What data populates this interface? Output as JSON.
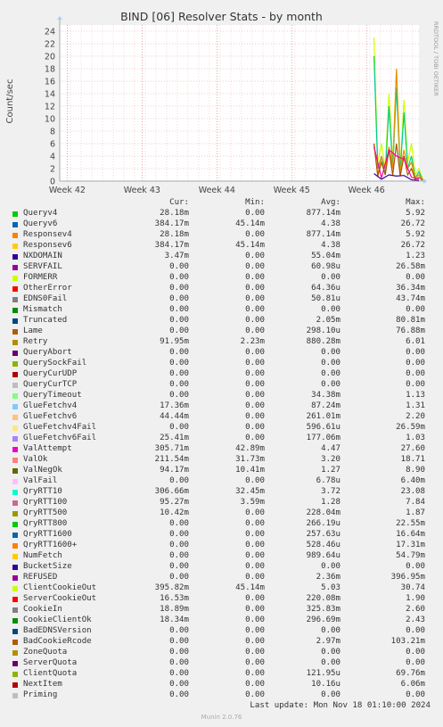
{
  "title": "BIND [06] Resolver Stats - by month",
  "side_text": "RRDTOOL / TOBI OETIKER",
  "chart_data": {
    "type": "line",
    "title": "BIND [06] Resolver Stats - by month",
    "ylabel": "Count/sec",
    "xlabel": "",
    "ylim": [
      0,
      25
    ],
    "yticks": [
      0,
      2,
      4,
      6,
      8,
      10,
      12,
      14,
      16,
      18,
      20,
      22,
      24
    ],
    "xticks": [
      "Week 42",
      "Week 43",
      "Week 44",
      "Week 45",
      "Week 46"
    ],
    "grid": true,
    "series": [
      {
        "name": "ClientCookieOut",
        "color": "#ccff00",
        "x": [
          46.1,
          46.15,
          46.2,
          46.25,
          46.3,
          46.35,
          46.4,
          46.45,
          46.5,
          46.55,
          46.6,
          46.65,
          46.7,
          46.75
        ],
        "values": [
          23.0,
          3.0,
          6.0,
          2.0,
          14.0,
          3.0,
          18.0,
          2.0,
          13.0,
          3.0,
          6.0,
          1.0,
          2.0,
          0.3
        ]
      },
      {
        "name": "QryRTT10",
        "color": "#00cc88",
        "x": [
          46.1,
          46.15,
          46.2,
          46.25,
          46.3,
          46.35,
          46.4,
          46.45,
          46.5,
          46.55,
          46.6,
          46.65,
          46.7,
          46.75
        ],
        "values": [
          20.0,
          2.0,
          4.0,
          1.0,
          12.0,
          2.0,
          15.0,
          1.5,
          11.0,
          2.0,
          4.0,
          0.5,
          1.5,
          0.2
        ]
      },
      {
        "name": "Queryv6",
        "color": "#ea8f00",
        "x": [
          46.1,
          46.15,
          46.2,
          46.25,
          46.3,
          46.35,
          46.4,
          46.45,
          46.5,
          46.55,
          46.6,
          46.65,
          46.7,
          46.75
        ],
        "values": [
          6.0,
          1.0,
          4.0,
          2.0,
          5.5,
          2.0,
          18.0,
          1.5,
          5.0,
          2.0,
          3.0,
          0.5,
          1.0,
          0.2
        ]
      },
      {
        "name": "Retry",
        "color": "#aa5500",
        "x": [
          46.1,
          46.15,
          46.2,
          46.25,
          46.3,
          46.35,
          46.4,
          46.45,
          46.5,
          46.55,
          46.6,
          46.65,
          46.7,
          46.75
        ],
        "values": [
          6.0,
          0.8,
          3.0,
          1.0,
          5.0,
          1.0,
          6.0,
          0.8,
          4.0,
          1.0,
          2.0,
          0.3,
          0.6,
          0.1
        ]
      },
      {
        "name": "ValAttempt",
        "color": "#ff0099",
        "x": [
          46.1,
          46.2,
          46.3,
          46.4,
          46.5,
          46.6,
          46.7
        ],
        "values": [
          5.5,
          0.5,
          5.0,
          4.0,
          3.5,
          0.6,
          0.3
        ]
      },
      {
        "name": "NXDOMAIN",
        "color": "#330099",
        "x": [
          46.1,
          46.2,
          46.3,
          46.4,
          46.5,
          46.6,
          46.7
        ],
        "values": [
          1.2,
          0.3,
          1.0,
          0.8,
          0.9,
          0.2,
          0.1
        ]
      }
    ]
  },
  "legend": {
    "headers": [
      "Cur:",
      "Min:",
      "Avg:",
      "Max:"
    ],
    "rows": [
      {
        "name": "Queryv4",
        "color": "#00cc00",
        "cur": "28.18m",
        "min": "0.00",
        "avg": "877.14m",
        "max": "5.92"
      },
      {
        "name": "Queryv6",
        "color": "#0066b3",
        "cur": "384.17m",
        "min": "45.14m",
        "avg": "4.38",
        "max": "26.72"
      },
      {
        "name": "Responsev4",
        "color": "#ff8000",
        "cur": "28.18m",
        "min": "0.00",
        "avg": "877.14m",
        "max": "5.92"
      },
      {
        "name": "Responsev6",
        "color": "#ffcc00",
        "cur": "384.17m",
        "min": "45.14m",
        "avg": "4.38",
        "max": "26.72"
      },
      {
        "name": "NXDOMAIN",
        "color": "#330099",
        "cur": "3.47m",
        "min": "0.00",
        "avg": "55.04m",
        "max": "1.23"
      },
      {
        "name": "SERVFAIL",
        "color": "#990099",
        "cur": "0.00",
        "min": "0.00",
        "avg": "60.98u",
        "max": "26.58m"
      },
      {
        "name": "FORMERR",
        "color": "#ccff00",
        "cur": "0.00",
        "min": "0.00",
        "avg": "0.00",
        "max": "0.00"
      },
      {
        "name": "OtherError",
        "color": "#ff0000",
        "cur": "0.00",
        "min": "0.00",
        "avg": "64.36u",
        "max": "36.34m"
      },
      {
        "name": "EDNS0Fail",
        "color": "#808080",
        "cur": "0.00",
        "min": "0.00",
        "avg": "50.81u",
        "max": "43.74m"
      },
      {
        "name": "Mismatch",
        "color": "#008f00",
        "cur": "0.00",
        "min": "0.00",
        "avg": "0.00",
        "max": "0.00"
      },
      {
        "name": "Truncated",
        "color": "#00487d",
        "cur": "0.00",
        "min": "0.00",
        "avg": "2.05m",
        "max": "80.81m"
      },
      {
        "name": "Lame",
        "color": "#b35a00",
        "cur": "0.00",
        "min": "0.00",
        "avg": "298.10u",
        "max": "76.88m"
      },
      {
        "name": "Retry",
        "color": "#b38f00",
        "cur": "91.95m",
        "min": "2.23m",
        "avg": "880.28m",
        "max": "6.01"
      },
      {
        "name": "QueryAbort",
        "color": "#6b006b",
        "cur": "0.00",
        "min": "0.00",
        "avg": "0.00",
        "max": "0.00"
      },
      {
        "name": "QuerySockFail",
        "color": "#8fb300",
        "cur": "0.00",
        "min": "0.00",
        "avg": "0.00",
        "max": "0.00"
      },
      {
        "name": "QueryCurUDP",
        "color": "#b30000",
        "cur": "0.00",
        "min": "0.00",
        "avg": "0.00",
        "max": "0.00"
      },
      {
        "name": "QueryCurTCP",
        "color": "#bebebe",
        "cur": "0.00",
        "min": "0.00",
        "avg": "0.00",
        "max": "0.00"
      },
      {
        "name": "QueryTimeout",
        "color": "#80ff80",
        "cur": "0.00",
        "min": "0.00",
        "avg": "34.38m",
        "max": "1.13"
      },
      {
        "name": "GlueFetchv4",
        "color": "#80c9ff",
        "cur": "17.36m",
        "min": "0.00",
        "avg": "87.24m",
        "max": "1.31"
      },
      {
        "name": "GlueFetchv6",
        "color": "#ffc080",
        "cur": "44.44m",
        "min": "0.00",
        "avg": "261.01m",
        "max": "2.20"
      },
      {
        "name": "GlueFetchv4Fail",
        "color": "#ffe680",
        "cur": "0.00",
        "min": "0.00",
        "avg": "596.61u",
        "max": "26.59m"
      },
      {
        "name": "GlueFetchv6Fail",
        "color": "#aa80ff",
        "cur": "25.41m",
        "min": "0.00",
        "avg": "177.06m",
        "max": "1.03"
      },
      {
        "name": "ValAttempt",
        "color": "#ee00cc",
        "cur": "305.71m",
        "min": "42.89m",
        "avg": "4.47",
        "max": "27.60"
      },
      {
        "name": "ValOk",
        "color": "#ff8080",
        "cur": "211.54m",
        "min": "31.73m",
        "avg": "3.20",
        "max": "18.71"
      },
      {
        "name": "ValNegOk",
        "color": "#666600",
        "cur": "94.17m",
        "min": "10.41m",
        "avg": "1.27",
        "max": "8.90"
      },
      {
        "name": "ValFail",
        "color": "#ffbfff",
        "cur": "0.00",
        "min": "0.00",
        "avg": "6.78u",
        "max": "6.40m"
      },
      {
        "name": "QryRTT10",
        "color": "#00ffcc",
        "cur": "306.66m",
        "min": "32.45m",
        "avg": "3.72",
        "max": "23.08"
      },
      {
        "name": "QryRTT100",
        "color": "#cc6699",
        "cur": "95.27m",
        "min": "3.59m",
        "avg": "1.28",
        "max": "7.84"
      },
      {
        "name": "QryRTT500",
        "color": "#999900",
        "cur": "10.42m",
        "min": "0.00",
        "avg": "228.04m",
        "max": "1.87"
      },
      {
        "name": "QryRTT800",
        "color": "#00cc00",
        "cur": "0.00",
        "min": "0.00",
        "avg": "266.19u",
        "max": "22.55m"
      },
      {
        "name": "QryRTT1600",
        "color": "#0066b3",
        "cur": "0.00",
        "min": "0.00",
        "avg": "257.63u",
        "max": "16.64m"
      },
      {
        "name": "QryRTT1600+",
        "color": "#ff8000",
        "cur": "0.00",
        "min": "0.00",
        "avg": "528.46u",
        "max": "17.31m"
      },
      {
        "name": "NumFetch",
        "color": "#ffcc00",
        "cur": "0.00",
        "min": "0.00",
        "avg": "989.64u",
        "max": "54.79m"
      },
      {
        "name": "BucketSize",
        "color": "#330099",
        "cur": "0.00",
        "min": "0.00",
        "avg": "0.00",
        "max": "0.00"
      },
      {
        "name": "REFUSED",
        "color": "#990099",
        "cur": "0.00",
        "min": "0.00",
        "avg": "2.36m",
        "max": "396.95m"
      },
      {
        "name": "ClientCookieOut",
        "color": "#ccff00",
        "cur": "395.82m",
        "min": "45.14m",
        "avg": "5.03",
        "max": "30.74"
      },
      {
        "name": "ServerCookieOut",
        "color": "#ff0000",
        "cur": "16.53m",
        "min": "0.00",
        "avg": "220.08m",
        "max": "1.90"
      },
      {
        "name": "CookieIn",
        "color": "#808080",
        "cur": "18.89m",
        "min": "0.00",
        "avg": "325.83m",
        "max": "2.60"
      },
      {
        "name": "CookieClientOk",
        "color": "#008f00",
        "cur": "18.34m",
        "min": "0.00",
        "avg": "296.69m",
        "max": "2.43"
      },
      {
        "name": "BadEDNSVersion",
        "color": "#00487d",
        "cur": "0.00",
        "min": "0.00",
        "avg": "0.00",
        "max": "0.00"
      },
      {
        "name": "BadCookieRcode",
        "color": "#b35a00",
        "cur": "0.00",
        "min": "0.00",
        "avg": "2.97m",
        "max": "103.21m"
      },
      {
        "name": "ZoneQuota",
        "color": "#b38f00",
        "cur": "0.00",
        "min": "0.00",
        "avg": "0.00",
        "max": "0.00"
      },
      {
        "name": "ServerQuota",
        "color": "#6b006b",
        "cur": "0.00",
        "min": "0.00",
        "avg": "0.00",
        "max": "0.00"
      },
      {
        "name": "ClientQuota",
        "color": "#8fb300",
        "cur": "0.00",
        "min": "0.00",
        "avg": "121.95u",
        "max": "69.76m"
      },
      {
        "name": "NextItem",
        "color": "#b30000",
        "cur": "0.00",
        "min": "0.00",
        "avg": "10.16u",
        "max": "6.06m"
      },
      {
        "name": "Priming",
        "color": "#bebebe",
        "cur": "0.00",
        "min": "0.00",
        "avg": "0.00",
        "max": "0.00"
      }
    ]
  },
  "last_update": "Last update: Mon Nov 18 01:10:00 2024",
  "footer": "Munin 2.0.76"
}
